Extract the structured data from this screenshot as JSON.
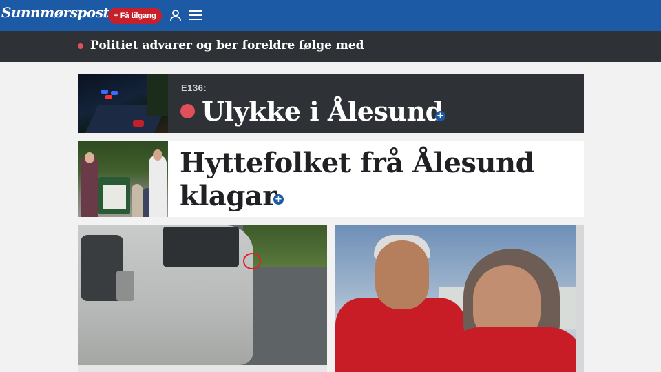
{
  "header": {
    "logo_text": "Sunnmørsposten",
    "cta_label": "+ Få tilgang",
    "icons": [
      "user-icon",
      "menu-icon"
    ]
  },
  "breaking": {
    "text": "Politiet advarer og ber foreldre følge med"
  },
  "articles": [
    {
      "kicker": "E136:",
      "headline": "Ulykke i Ålesund",
      "premium": "+"
    },
    {
      "headline_line1": "Hyttefolket frå Ålesund",
      "headline_line2": "klagar",
      "premium": "+"
    }
  ],
  "colors": {
    "brand_blue": "#1c5aa6",
    "breaking_bg": "#2e3135",
    "cta_red": "#c8202b",
    "live_dot": "#e0505a"
  }
}
